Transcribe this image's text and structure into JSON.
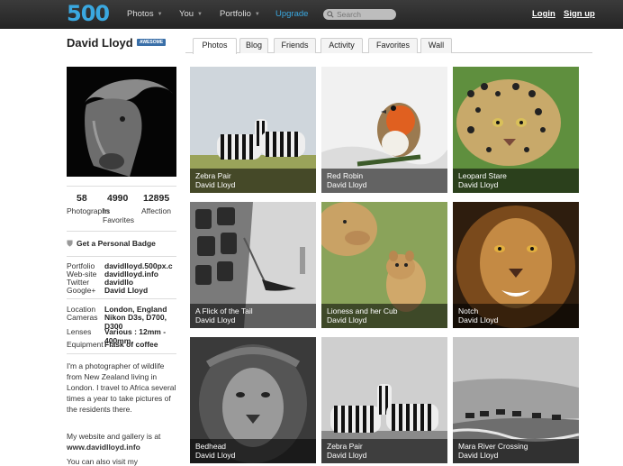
{
  "header": {
    "logo_text": "500",
    "nav": [
      {
        "label": "Photos",
        "dropdown": true
      },
      {
        "label": "You",
        "dropdown": true
      },
      {
        "label": "Portfolio",
        "dropdown": true
      },
      {
        "label": "Upgrade",
        "dropdown": false
      }
    ],
    "search_placeholder": "Search",
    "login": "Login",
    "signup": "Sign up"
  },
  "profile": {
    "name": "David Lloyd",
    "badge": "AWESOME",
    "stats": [
      {
        "value": "58",
        "label": "Photographs"
      },
      {
        "value": "4990",
        "label": "In Favorites"
      },
      {
        "value": "12895",
        "label": "Affection"
      }
    ],
    "get_badge": "Get a Personal Badge",
    "links": [
      {
        "key": "Portfolio",
        "value": "davidlloyd.500px.c"
      },
      {
        "key": "Web-site",
        "value": "davidlloyd.info"
      },
      {
        "key": "Twitter",
        "value": "davidllo"
      },
      {
        "key": "Google+",
        "value": "David Lloyd"
      }
    ],
    "details": [
      {
        "key": "Location",
        "value": "London, England"
      },
      {
        "key": "Cameras",
        "value": "Nikon D3s, D700, D300"
      },
      {
        "key": "Lenses",
        "value": "Various : 12mm - 400mm"
      },
      {
        "key": "Equipment",
        "value": "Flask of coffee"
      }
    ],
    "bio_1": "I'm a photographer of wildlife from New Zealand living in London. I travel to Africa several times a year to take pictures of the residents there.",
    "bio_2_prefix": "My website and gallery is at",
    "bio_2_link": "www.davidlloyd.info",
    "bio_3": "You can also visit my"
  },
  "tabs": [
    "Photos",
    "Blog",
    "Friends",
    "Activity",
    "Favorites",
    "Wall"
  ],
  "active_tab": "Photos",
  "photos": [
    {
      "title": "Zebra Pair",
      "author": "David Lloyd"
    },
    {
      "title": "Red Robin",
      "author": "David Lloyd"
    },
    {
      "title": "Leopard Stare",
      "author": "David Lloyd"
    },
    {
      "title": "A Flick of the Tail",
      "author": "David Lloyd"
    },
    {
      "title": "Lioness and her Cub",
      "author": "David Lloyd"
    },
    {
      "title": "Notch",
      "author": "David Lloyd"
    },
    {
      "title": "Bedhead",
      "author": "David Lloyd"
    },
    {
      "title": "Zebra Pair",
      "author": "David Lloyd"
    },
    {
      "title": "Mara River Crossing",
      "author": "David Lloyd"
    }
  ],
  "colors": {
    "brand": "#3aa8e0",
    "topbar": "#2e2e2e",
    "badge": "#3a6fa8"
  }
}
